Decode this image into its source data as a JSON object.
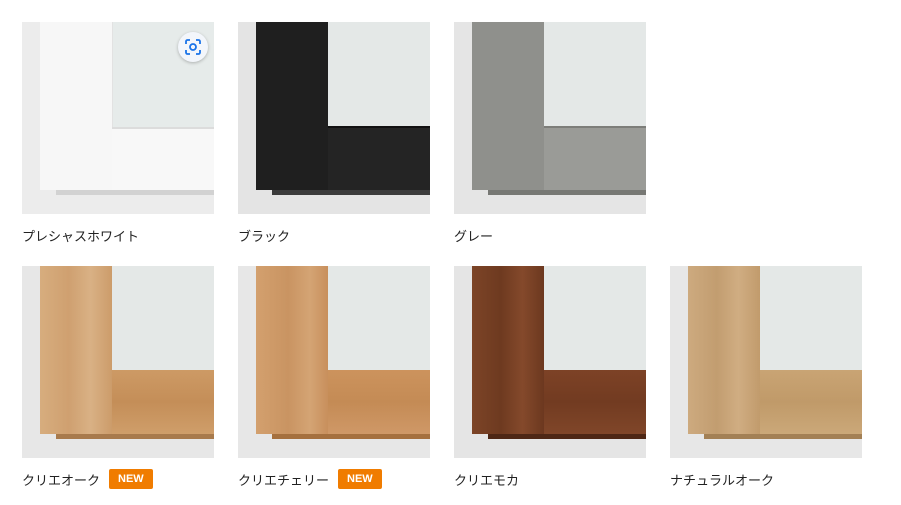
{
  "items": [
    {
      "label": "プレシャスホワイト",
      "badge": "",
      "frame": "#f4f4f4",
      "rail": "#f7f7f7",
      "shadow": "#d9d9d9",
      "bg": "#eeeeee"
    },
    {
      "label": "ブラック",
      "badge": "",
      "frame": "#1e1e1e",
      "rail": "#232323",
      "shadow": "#3a3a3a",
      "bg": "#e6e6e6"
    },
    {
      "label": "グレー",
      "badge": "",
      "frame": "#8e8f8b",
      "rail": "#999a96",
      "shadow": "#7a7b77",
      "bg": "#e8e8e8"
    },
    {
      "label": "クリエオーク",
      "badge": "NEW",
      "frame": "#d4a877",
      "rail": "#c9955f",
      "shadow": "#a8784a",
      "bg": "#e8e8e8"
    },
    {
      "label": "クリエチェリー",
      "badge": "NEW",
      "frame": "#cf9c6a",
      "rail": "#c98f59",
      "shadow": "#a7713f",
      "bg": "#e8e8e8"
    },
    {
      "label": "クリエモカ",
      "badge": "",
      "frame": "#7a4326",
      "rail": "#7b4024",
      "shadow": "#4f2815",
      "bg": "#e6e6e6"
    },
    {
      "label": "ナチュラルオーク",
      "badge": "",
      "frame": "#c9a57a",
      "rail": "#c6a170",
      "shadow": "#a48258",
      "bg": "#e8e8e8"
    }
  ],
  "lens": {
    "icon": "visual-search-icon"
  }
}
